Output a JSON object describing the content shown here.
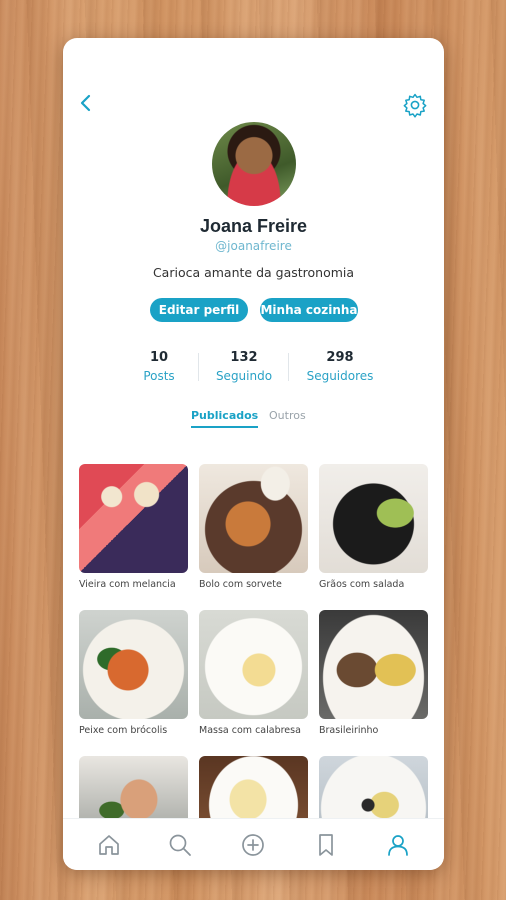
{
  "profile": {
    "name": "Joana Freire",
    "handle": "@joanafreire",
    "bio": "Carioca amante da gastronomia"
  },
  "actions": {
    "edit_label": "Editar perfil",
    "kitchen_label": "Minha cozinha"
  },
  "stats": [
    {
      "value": "10",
      "label": "Posts"
    },
    {
      "value": "132",
      "label": "Seguindo"
    },
    {
      "value": "298",
      "label": "Seguidores"
    }
  ],
  "tabs": [
    {
      "label": "Publicados",
      "active": true
    },
    {
      "label": "Outros",
      "active": false
    }
  ],
  "posts": [
    {
      "caption": "Vieira com melancia"
    },
    {
      "caption": "Bolo com sorvete"
    },
    {
      "caption": "Grãos com salada"
    },
    {
      "caption": "Peixe com brócolis"
    },
    {
      "caption": "Massa com calabresa"
    },
    {
      "caption": "Brasileirinho"
    },
    {
      "caption": ""
    },
    {
      "caption": ""
    },
    {
      "caption": ""
    }
  ],
  "icons": {
    "back": "chevron-left-icon",
    "settings": "gear-icon",
    "nav": [
      "home-icon",
      "search-icon",
      "add-circle-icon",
      "bookmark-icon",
      "user-icon"
    ]
  },
  "colors": {
    "accent": "#1aa2c6",
    "nav_inactive": "#8a949b"
  }
}
